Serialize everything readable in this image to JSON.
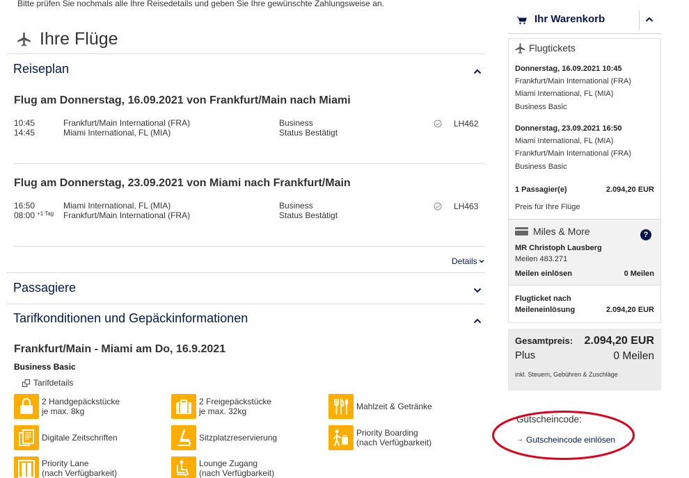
{
  "page": {
    "instruction": "Bitte prüfen Sie nochmals alle Ihre Reisedetails und geben Sie Ihre gewünschte Zahlungsweise an.",
    "title": "Ihre Flüge"
  },
  "colors": {
    "brand_blue": "#05164d",
    "amenity_yellow": "#ffad00",
    "panel_gray": "#ebebeb",
    "highlight_red": "#e0001b"
  },
  "itinerary": {
    "section_title": "Reiseplan",
    "flights": [
      {
        "title": "Flug am Donnerstag, 16.09.2021 von Frankfurt/Main nach Miami",
        "departure_time": "10:45",
        "arrival_time": "14:45",
        "origin": "Frankfurt/Main International (FRA)",
        "destination": "Miami International, FL (MIA)",
        "cabin": "Business",
        "status": "Status Bestätigt",
        "flight_number": "LH462"
      },
      {
        "title": "Flug am Donnerstag, 23.09.2021 von Miami nach Frankfurt/Main",
        "departure_time": "16:50",
        "arrival_time": "08:00",
        "arrival_day_offset": "+1 Tag",
        "origin": "Miami International, FL (MIA)",
        "destination": "Frankfurt/Main International (FRA)",
        "cabin": "Business",
        "status": "Status Bestätigt",
        "flight_number": "LH463"
      }
    ],
    "details_link": "Details"
  },
  "passengers": {
    "section_title": "Passagiere"
  },
  "fares": {
    "section_title": "Tarifkonditionen und Gepäckinformationen",
    "route_title": "Frankfurt/Main - Miami am Do, 16.9.2021",
    "fare_name": "Business Basic",
    "fare_details_link": "Tarifdetails",
    "amenities": [
      {
        "icon": "hand-baggage-icon",
        "line1": "2 Handgepäckstücke",
        "line2": "je max. 8kg"
      },
      {
        "icon": "checked-baggage-icon",
        "line1": "2 Freigepäckstücke",
        "line2": "je max. 32kg"
      },
      {
        "icon": "meal-icon",
        "line1": "Mahlzeit & Getränke"
      },
      {
        "icon": "magazine-icon",
        "line1": "Digitale Zeitschriften"
      },
      {
        "icon": "seat-icon",
        "line1": "Sitzplatzreservierung"
      },
      {
        "icon": "priority-boarding-icon",
        "line1": "Priority Boarding",
        "line2": "(nach Verfügbarkeit)"
      },
      {
        "icon": "priority-lane-icon",
        "line1": "Priority Lane",
        "line2": "(nach Verfügbarkeit)"
      },
      {
        "icon": "lounge-icon",
        "line1": "Lounge Zugang",
        "line2": "(nach Verfügbarkeit)"
      }
    ]
  },
  "cart": {
    "title": "Ihr Warenkorb",
    "tickets_heading": "Flugtickets",
    "segments": [
      {
        "datetime": "Donnerstag, 16.09.2021 10:45",
        "from": "Frankfurt/Main International (FRA)",
        "to": "Miami International, FL (MIA)",
        "fare": "Business Basic"
      },
      {
        "datetime": "Donnerstag, 23.09.2021 16:50",
        "from": "Miami International, FL (MIA)",
        "to": "Frankfurt/Main International (FRA)",
        "fare": "Business Basic"
      }
    ],
    "passengers_label": "1 Passagier(e)",
    "passengers_price": "2.094,20 EUR",
    "price_note": "Preis für Ihre Flüge",
    "miles": {
      "title": "Miles & More",
      "help_glyph": "?",
      "member_name": "MR Christoph Lausberg",
      "balance": "Meilen 483.271",
      "redeem_label": "Meilen einlösen",
      "redeem_value": "0 Meilen"
    },
    "miles_ticket": {
      "label_line1": "Flugticket nach",
      "label_line2": "Meileneinlösung",
      "price": "2.094,20 EUR"
    },
    "total": {
      "label": "Gesamtpreis:",
      "price": "2.094,20 EUR",
      "plus_label": "Plus",
      "plus_value": "0 Meilen",
      "note": "inkl. Steuern, Gebühren & Zuschläge"
    }
  },
  "voucher": {
    "label": "Gutscheincode:",
    "arrow": "→",
    "link": "Gutscheincode einlösen"
  }
}
